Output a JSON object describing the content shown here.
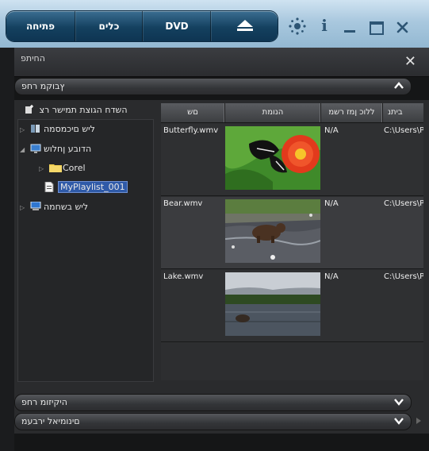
{
  "toolbar": {
    "open_label": "פתיחה",
    "tools_label": "כלים",
    "dvd_label": "DVD"
  },
  "window": {
    "title": "החיתפ",
    "sections": {
      "media_library": "ץבוקמ רחפ",
      "music_library": "היקיזומ רחפ",
      "transition_library": "םינומיאל ירבעמ"
    }
  },
  "tree": {
    "new_playlist": "השדח הגוצת תמישר רצ",
    "items": [
      {
        "label": "ליש םיכמסמה"
      },
      {
        "label": "הדובע ןחלוש"
      },
      {
        "label": "Corel"
      },
      {
        "label": "MyPlaylist_001"
      },
      {
        "label": "ליש בשחמה"
      }
    ]
  },
  "list": {
    "columns": [
      "םש",
      "הנומת",
      "ללוכ ןמז רשמ",
      "ביתנ"
    ],
    "rows": [
      {
        "name": "Butterfly.wmv",
        "duration": "N/A",
        "path": "C:\\Users\\P"
      },
      {
        "name": "Bear.wmv",
        "duration": "N/A",
        "path": "C:\\Users\\P"
      },
      {
        "name": "Lake.wmv",
        "duration": "N/A",
        "path": "C:\\Users\\P"
      }
    ]
  },
  "icons": [
    "eject-icon",
    "settings-icon",
    "info-icon",
    "minimize-icon",
    "maximize-icon",
    "close-icon"
  ]
}
